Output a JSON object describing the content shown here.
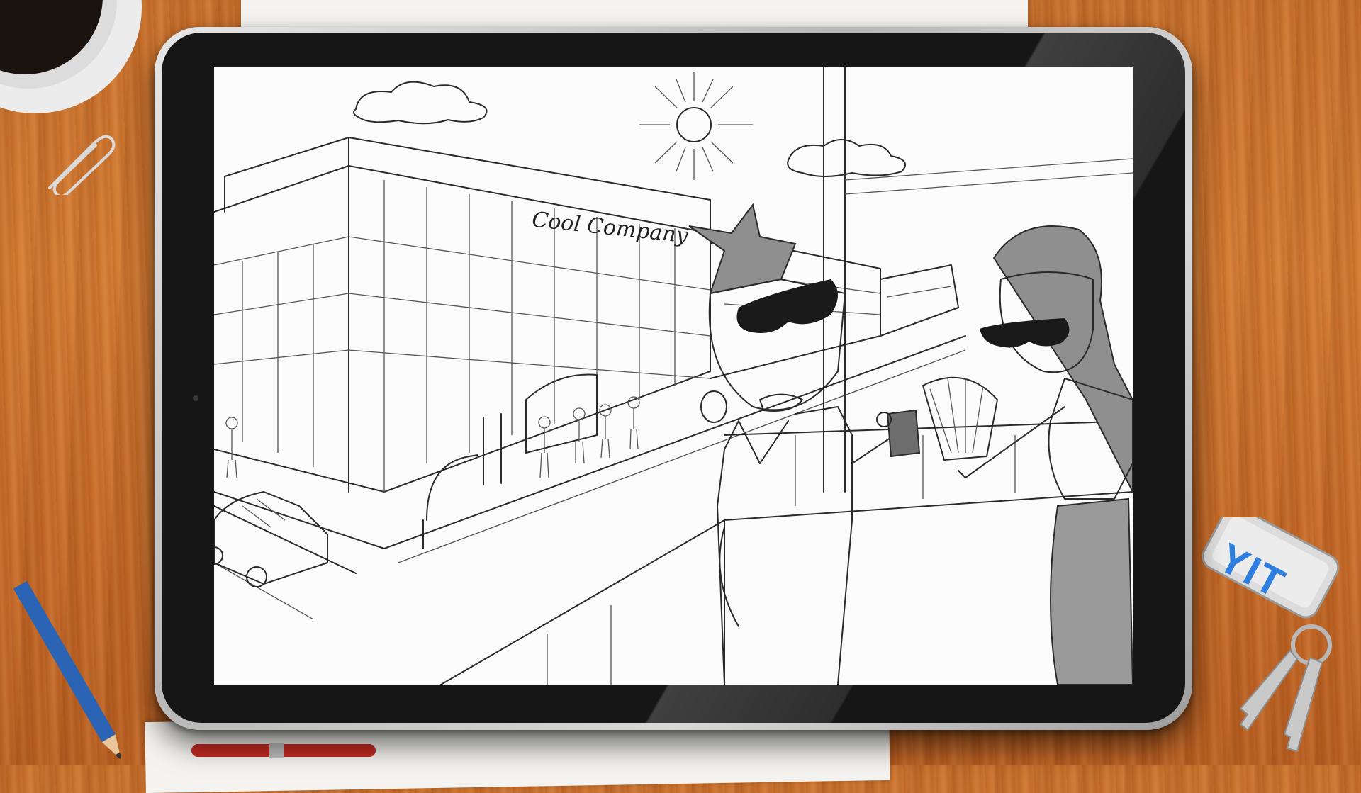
{
  "scene": {
    "building_sign": "Cool Company"
  },
  "desk": {
    "keytag_logo": "YIT"
  },
  "colors": {
    "desk_wood": "#c8702c",
    "tablet_bezel": "#161616",
    "keytag_logo": "#2f7fe0",
    "pencil": "#2b63b5"
  }
}
